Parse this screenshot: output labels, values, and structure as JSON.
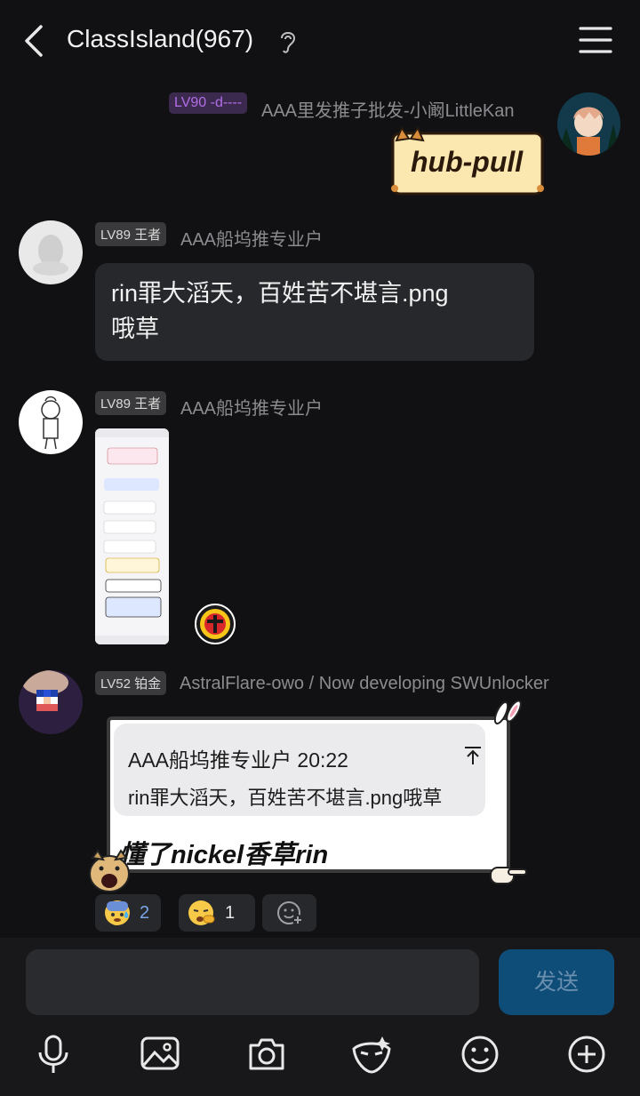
{
  "header": {
    "title": "ClassIsland(967)"
  },
  "messages": [
    {
      "badge": "LV90 -d----",
      "nick": "AAA里发推子批发-小阚LittleKan",
      "sticker_text": "hub-pull"
    },
    {
      "badge": "LV89 王者",
      "nick": "AAA船坞推专业户",
      "text_line1": "rin罪大滔天，百姓苦不堪言.png",
      "text_line2": "哦草"
    },
    {
      "badge": "LV89 王者",
      "nick": "AAA船坞推专业户"
    },
    {
      "badge": "LV52 铂金",
      "nick": "AstralFlare-owo / Now developing SWUnlocker",
      "quote_header": "AAA船坞推专业户 20:22",
      "quote_text": "rin罪大滔天，百姓苦不堪言.png哦草",
      "reply_text": "懂了nickel香草rin"
    }
  ],
  "reactions": [
    {
      "count": "2"
    },
    {
      "count": "1"
    }
  ],
  "composer": {
    "send_label": "发送"
  },
  "colors": {
    "bg": "#111113",
    "bubble": "#26282c",
    "send": "#0f4d79",
    "accent_purple": "#a86be0"
  }
}
